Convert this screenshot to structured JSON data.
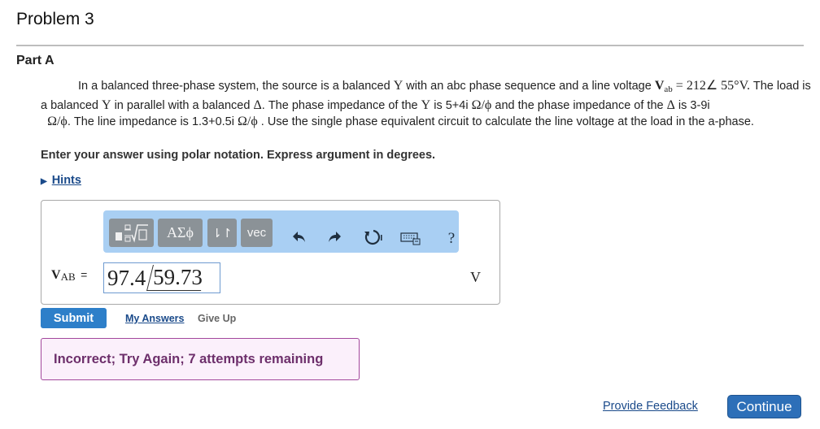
{
  "problem": {
    "title": "Problem 3"
  },
  "part": {
    "label": "Part A"
  },
  "question": {
    "t1": "In a balanced three-phase system, the source is a balanced ",
    "y1": "Y",
    "t2": " with an abc phase sequence and a line voltage ",
    "v_symbol": "V",
    "v_sub": "ab",
    "v_value": " = 212∠ 55°V.",
    "t3": "The load is a balanced ",
    "y2": "Y",
    "t4": " in parallel with a balanced ",
    "delta1": "Δ",
    "t5": ". The phase impedance of the ",
    "y3": "Y",
    "t6": " is 5+4i ",
    "unit1": "Ω/ϕ",
    "t7": " and the phase impedance of the ",
    "delta2": "Δ",
    "t8": " is 3-9i ",
    "unit2": "Ω/ϕ",
    "t9": ". The line impedance is 1.3+0.5i ",
    "unit3": "Ω/ϕ",
    "t10": " . Use the single phase equivalent circuit to calculate the line voltage at the load in the a-phase."
  },
  "instruction": "Enter your answer using polar notation. Express argument in degrees.",
  "hints": {
    "label": "Hints"
  },
  "toolbar": {
    "greek_label": "ΑΣϕ",
    "arrows_label": "⇂↾",
    "vec_label": "vec",
    "help_label": "?"
  },
  "answer": {
    "var_symbol": "V",
    "var_sub": "AB",
    "equals": "=",
    "magnitude": "97.4",
    "angle": "59.73",
    "unit": "V"
  },
  "actions": {
    "submit": "Submit",
    "my_answers": "My Answers",
    "give_up": "Give Up"
  },
  "feedback": {
    "message": "Incorrect; Try Again; 7 attempts remaining"
  },
  "footer": {
    "provide_feedback": "Provide Feedback",
    "continue": "Continue"
  },
  "colors": {
    "toolbar_bg": "#a9cff3",
    "submit_bg": "#2d7fc9",
    "feedback_border": "#a2479c",
    "feedback_bg": "#fbf0fb",
    "link": "#1a4a8a"
  }
}
